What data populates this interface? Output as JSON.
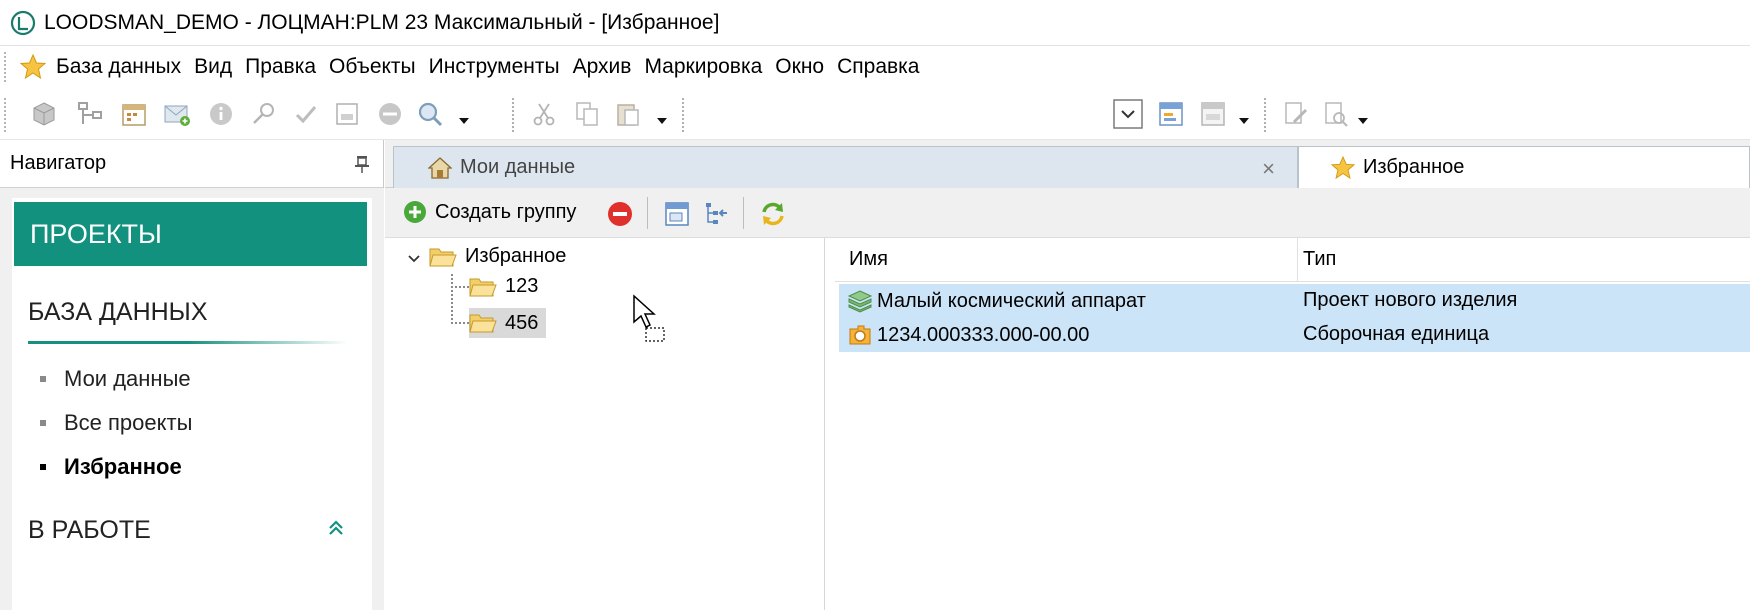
{
  "window": {
    "title": "LOODSMAN_DEMO - ЛОЦМАН:PLM 23 Максимальный - [Избранное]"
  },
  "menu": {
    "items": [
      "База данных",
      "Вид",
      "Правка",
      "Объекты",
      "Инструменты",
      "Архив",
      "Маркировка",
      "Окно",
      "Справка"
    ]
  },
  "toolbar": {
    "icons": [
      "cube-icon",
      "structure-icon",
      "calendar-icon",
      "mail-icon",
      "info-icon",
      "key-icon",
      "check-icon",
      "form-icon",
      "stop-icon",
      "search-icon",
      "cut-icon",
      "copy-icon",
      "paste-icon",
      "dropdown-icon",
      "edit-form-icon",
      "form-icon",
      "edit-doc-icon",
      "doc-search-icon"
    ]
  },
  "navigator": {
    "title": "Навигатор",
    "projects_label": "ПРОЕКТЫ",
    "database_section": "БАЗА ДАННЫХ",
    "links": [
      "Мои данные",
      "Все проекты",
      "Избранное"
    ],
    "active_link": "Избранное",
    "work_section": "В РАБОТЕ"
  },
  "tabs": [
    {
      "label": "Мои данные",
      "icon": "home-icon",
      "close": "×"
    },
    {
      "label": "Избранное",
      "icon": "star-icon"
    }
  ],
  "content_toolbar": {
    "create_group": "Создать группу"
  },
  "tree": {
    "root": "Избранное",
    "children": [
      "123",
      "456"
    ],
    "selected": "456"
  },
  "list": {
    "columns": [
      "Имя",
      "Тип"
    ],
    "rows": [
      {
        "name": "Малый космический аппарат",
        "type": "Проект нового изделия",
        "icon": "project-icon"
      },
      {
        "name": "1234.000333.000-00.00",
        "type": "Сборочная единица",
        "icon": "assembly-icon"
      }
    ]
  },
  "colors": {
    "accent": "#13917f",
    "selection": "#cce4f7",
    "tab_inactive": "#dde6ef"
  }
}
